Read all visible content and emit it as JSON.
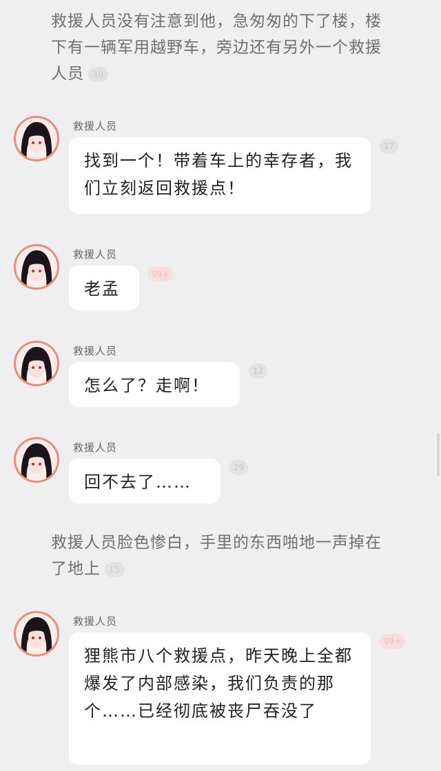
{
  "narrations": [
    {
      "text": "救援人员没有注意到他，急匆匆的下了楼，楼下有一辆军用越野车，旁边还有另外一个救援人员",
      "comments": "30"
    },
    {
      "text": "救援人员脸色惨白，手里的东西啪地一声掉在了地上",
      "comments": "15"
    }
  ],
  "messages": [
    {
      "speaker": "救援人员",
      "text": "找到一个！带着车上的幸存者，我们立刻返回救援点！",
      "comments": "17",
      "hot": false
    },
    {
      "speaker": "救援人员",
      "text": "老孟",
      "comments": "99+",
      "hot": true
    },
    {
      "speaker": "救援人员",
      "text": "怎么了？走啊！",
      "comments": "12",
      "hot": false
    },
    {
      "speaker": "救援人员",
      "text": "回不去了……",
      "comments": "29",
      "hot": false
    },
    {
      "speaker": "救援人员",
      "text": "狸熊市八个救援点，昨天晚上全都爆发了内部感染，我们负责的那个……已经彻底被丧尸吞没了",
      "comments": "99+",
      "hot": true
    }
  ],
  "colors": {
    "background": "#efefef",
    "bubble": "#ffffff",
    "avatar_ring": "#ef8a74",
    "hot_badge": "#f6dede"
  },
  "icons": {
    "avatar": "dark-haired-girl-avatar-icon"
  }
}
